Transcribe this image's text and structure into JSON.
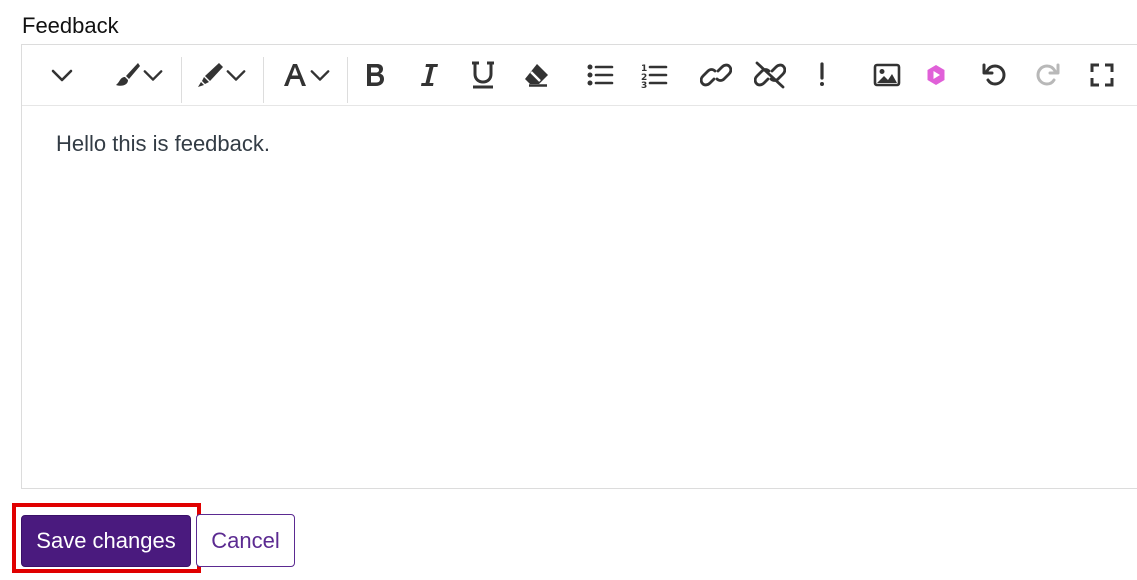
{
  "field": {
    "label": "Feedback"
  },
  "editor": {
    "content": "Hello this is feedback."
  },
  "toolbar": {
    "icons": [
      "collapse-chevron-icon",
      "paintbrush-icon",
      "highlighter-icon",
      "font-color-icon",
      "bold-icon",
      "italic-icon",
      "underline-icon",
      "eraser-icon",
      "bullet-list-icon",
      "numbered-list-icon",
      "link-icon",
      "unlink-icon",
      "exclamation-icon",
      "image-icon",
      "media-icon",
      "undo-icon",
      "redo-icon",
      "fullscreen-icon"
    ],
    "media_icon_color": "#e060d8"
  },
  "actions": {
    "save_label": "Save changes",
    "cancel_label": "Cancel"
  },
  "colors": {
    "primary": "#4a1a7e",
    "focus_outline": "#e00000",
    "icon": "#333333"
  }
}
